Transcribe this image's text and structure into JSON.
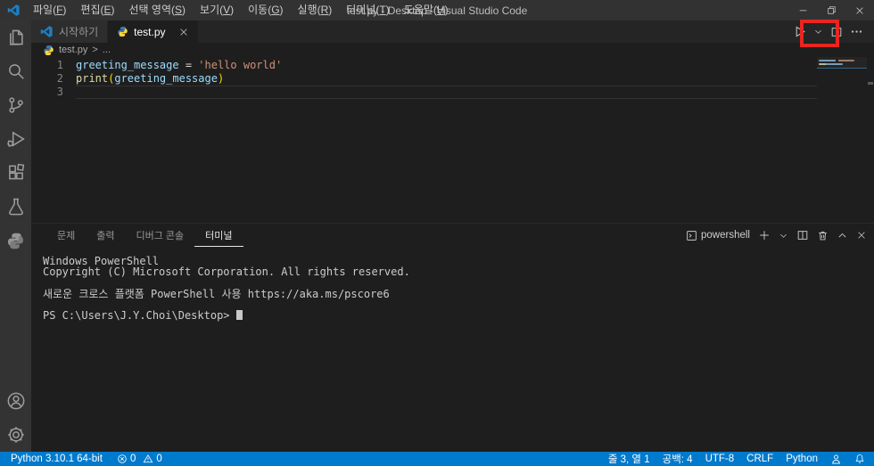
{
  "title_bar": {
    "title": "test.py - Desktop - Visual Studio Code",
    "menus": [
      "파일(F)",
      "편집(E)",
      "선택 영역(S)",
      "보기(V)",
      "이동(G)",
      "실행(R)",
      "터미널(T)",
      "도움말(H)"
    ],
    "window_controls": [
      {
        "name": "minimize-button",
        "icon": "minimize-icon"
      },
      {
        "name": "restore-button",
        "icon": "restore-icon"
      },
      {
        "name": "close-button",
        "icon": "close-icon"
      }
    ]
  },
  "activity_bar": {
    "top": [
      {
        "name": "explorer",
        "icon": "files-icon"
      },
      {
        "name": "search",
        "icon": "search-icon"
      },
      {
        "name": "source-control",
        "icon": "source-control-icon"
      },
      {
        "name": "run-and-debug",
        "icon": "run-debug-icon"
      },
      {
        "name": "extensions",
        "icon": "extensions-icon"
      },
      {
        "name": "testing",
        "icon": "flask-icon"
      },
      {
        "name": "python",
        "icon": "python-gray-icon"
      }
    ],
    "bottom": [
      {
        "name": "accounts",
        "icon": "account-icon"
      },
      {
        "name": "settings",
        "icon": "gear-icon"
      }
    ]
  },
  "tabs": [
    {
      "label": "시작하기",
      "icon": "vscode-logo-icon",
      "active": false,
      "closable": false
    },
    {
      "label": "test.py",
      "icon": "python-color-icon",
      "active": true,
      "closable": true
    }
  ],
  "editor_actions": [
    {
      "name": "run-button",
      "icon": "play-icon"
    },
    {
      "name": "run-dropdown-button",
      "icon": "chevron-down-icon"
    },
    {
      "name": "split-editor-button",
      "icon": "split-icon"
    },
    {
      "name": "more-actions-button",
      "icon": "ellipsis-icon"
    }
  ],
  "breadcrumb": {
    "file": "test.py",
    "separator": ">",
    "more": "..."
  },
  "editor": {
    "lines": [
      {
        "number": "1",
        "current": false,
        "tokens": [
          {
            "text": "greeting_message",
            "type": "variable"
          },
          {
            "text": " = ",
            "type": "default"
          },
          {
            "text": "'hello world'",
            "type": "string"
          }
        ]
      },
      {
        "number": "2",
        "current": false,
        "tokens": [
          {
            "text": "print",
            "type": "function"
          },
          {
            "text": "(",
            "type": "bracket"
          },
          {
            "text": "greeting_message",
            "type": "variable"
          },
          {
            "text": ")",
            "type": "bracket"
          }
        ]
      },
      {
        "number": "3",
        "current": true,
        "tokens": []
      }
    ]
  },
  "panel": {
    "tabs": [
      {
        "label": "문제",
        "active": false
      },
      {
        "label": "출력",
        "active": false
      },
      {
        "label": "디버그 콘솔",
        "active": false
      },
      {
        "label": "터미널",
        "active": true
      }
    ],
    "shell_label": "powershell",
    "shell_icon": "terminal-icon",
    "actions": [
      {
        "name": "new-terminal-button",
        "icon": "plus-icon"
      },
      {
        "name": "terminal-profile-dropdown",
        "icon": "chevron-down-icon"
      },
      {
        "name": "split-terminal-button",
        "icon": "split-icon"
      },
      {
        "name": "kill-terminal-button",
        "icon": "trash-icon"
      },
      {
        "name": "maximize-panel-button",
        "icon": "chevron-up-icon"
      },
      {
        "name": "close-panel-button",
        "icon": "close-icon"
      }
    ],
    "terminal_lines": [
      {
        "text": "Windows PowerShell",
        "cursor": false
      },
      {
        "text": "Copyright (C) Microsoft Corporation. All rights reserved.",
        "cursor": false
      },
      {
        "text": "",
        "cursor": false
      },
      {
        "text": "새로운 크로스 플랫폼 PowerShell 사용 https://aka.ms/pscore6",
        "cursor": false
      },
      {
        "text": "",
        "cursor": false
      },
      {
        "text": "PS C:\\Users\\J.Y.Choi\\Desktop> ",
        "cursor": true
      }
    ]
  },
  "status_bar": {
    "python_version": "Python 3.10.1 64-bit",
    "errors": "0",
    "warnings": "0",
    "right_items": [
      "줄 3, 열 1",
      "공백: 4",
      "UTF-8",
      "CRLF",
      "Python"
    ],
    "right_icons": [
      "feedback-icon",
      "bell-icon"
    ]
  },
  "colors": {
    "status_bar_blue": "#007acc",
    "annotation_red": "#e8251f",
    "activity_bar_bg": "#333333",
    "title_bar_bg": "#323233",
    "editor_bg": "#1e1e1e"
  }
}
